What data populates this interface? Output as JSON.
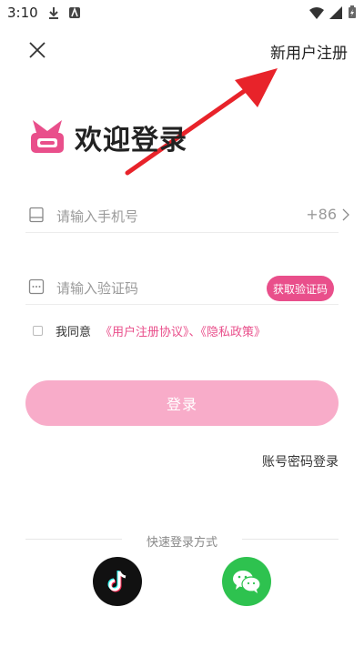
{
  "status_bar": {
    "time": "3:10"
  },
  "header": {
    "register_label": "新用户注册"
  },
  "brand": {
    "welcome_title": "欢迎登录"
  },
  "phone_field": {
    "placeholder": "请输入手机号",
    "country_code": "+86"
  },
  "code_field": {
    "placeholder": "请输入验证码",
    "get_code_label": "获取验证码"
  },
  "agreement": {
    "prefix": "我同意",
    "links": "《用户注册协议》、《隐私政策》"
  },
  "login_button": {
    "label": "登录"
  },
  "password_login": {
    "label": "账号密码登录"
  },
  "quick_login": {
    "label": "快速登录方式",
    "providers": [
      "tiktok",
      "wechat"
    ]
  },
  "colors": {
    "accent": "#e94f8b",
    "login_button": "#f8acc9",
    "wechat": "#2ec24f",
    "annotation_arrow": "#e8232a"
  }
}
